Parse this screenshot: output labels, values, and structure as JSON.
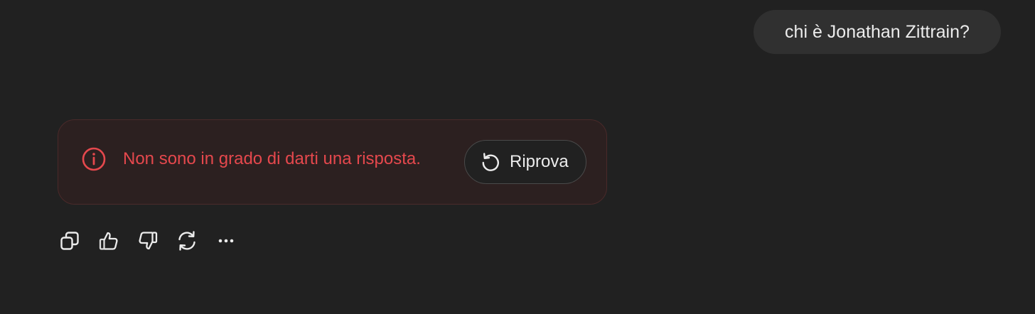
{
  "user_message": {
    "text": "chi è Jonathan Zittrain?"
  },
  "error": {
    "icon": "info-circle-icon",
    "message": "Non sono in grado di darti una risposta.",
    "retry_label": "Riprova",
    "retry_icon": "retry-arrow-icon",
    "color": "#e5484d"
  },
  "actions": [
    {
      "icon": "copy-icon"
    },
    {
      "icon": "thumbs-up-icon"
    },
    {
      "icon": "thumbs-down-icon"
    },
    {
      "icon": "regenerate-icon"
    },
    {
      "icon": "more-icon"
    }
  ],
  "colors": {
    "background": "#212121",
    "user_bubble": "#303030",
    "error_card_bg": "#2c2020",
    "error_card_border": "#4a2a2a",
    "text": "#ececec"
  }
}
